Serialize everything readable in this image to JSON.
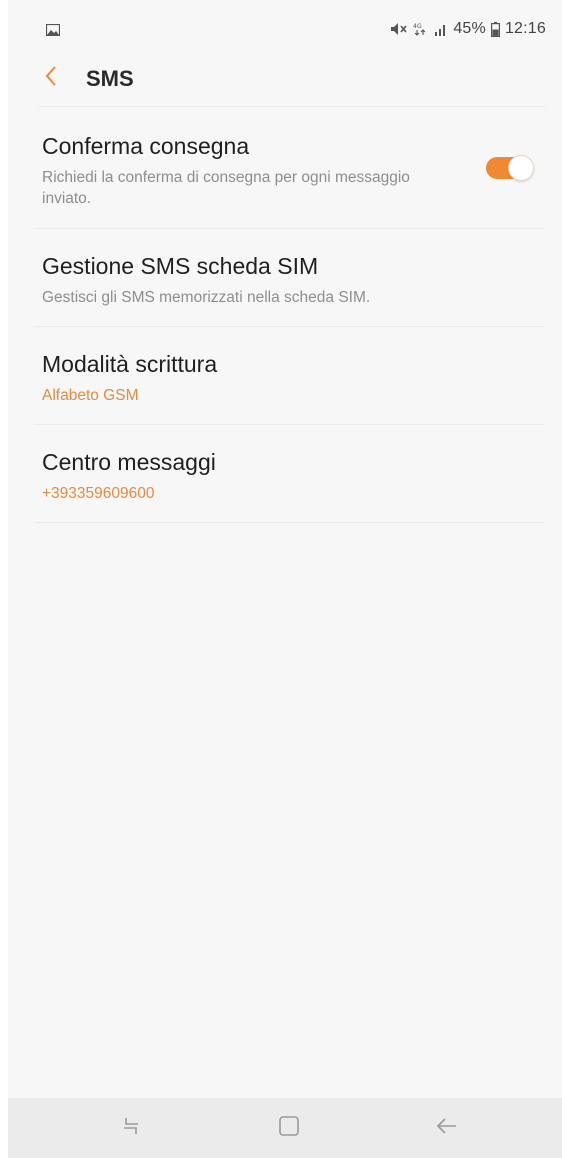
{
  "status_bar": {
    "battery_percent": "45%",
    "time": "12:16",
    "icons": [
      "image-icon",
      "mute-icon",
      "data-icon",
      "signal-icon",
      "battery-icon"
    ]
  },
  "header": {
    "title": "SMS",
    "back_icon": "chevron-left-icon"
  },
  "settings": [
    {
      "title": "Conferma consegna",
      "summary": "Richiedi la conferma di consegna per ogni messaggio inviato.",
      "toggle_on": true
    },
    {
      "title": "Gestione SMS scheda SIM",
      "summary": "Gestisci gli SMS memorizzati nella scheda SIM."
    },
    {
      "title": "Modalità scrittura",
      "value": "Alfabeto GSM"
    },
    {
      "title": "Centro messaggi",
      "value": "+393359609600"
    }
  ],
  "nav_bar": {
    "icons": [
      "recent-apps-icon",
      "home-icon",
      "back-arrow-icon"
    ]
  },
  "colors": {
    "accent": "#ef8a32",
    "value_text": "#e9893d",
    "background": "#f7f7f7"
  }
}
